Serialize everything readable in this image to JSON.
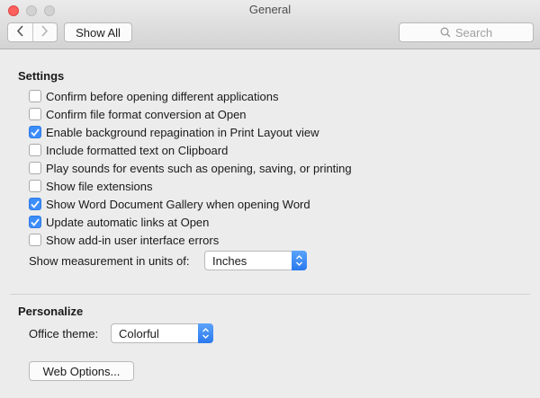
{
  "window": {
    "title": "General"
  },
  "toolbar": {
    "back_icon": "chevron-left-icon",
    "forward_icon": "chevron-right-icon",
    "show_all_label": "Show All",
    "search_placeholder": "Search"
  },
  "settings": {
    "heading": "Settings",
    "options": [
      {
        "label": "Confirm before opening different applications",
        "checked": false
      },
      {
        "label": "Confirm file format conversion at Open",
        "checked": false
      },
      {
        "label": "Enable background repagination in Print Layout view",
        "checked": true
      },
      {
        "label": "Include formatted text on Clipboard",
        "checked": false
      },
      {
        "label": "Play sounds for events such as opening, saving, or printing",
        "checked": false
      },
      {
        "label": "Show file extensions",
        "checked": false
      },
      {
        "label": "Show Word Document Gallery when opening Word",
        "checked": true
      },
      {
        "label": "Update automatic links at Open",
        "checked": true
      },
      {
        "label": "Show add-in user interface errors",
        "checked": false
      }
    ],
    "units_label": "Show measurement in units of:",
    "units_value": "Inches"
  },
  "personalize": {
    "heading": "Personalize",
    "theme_label": "Office theme:",
    "theme_value": "Colorful",
    "web_options_label": "Web Options..."
  },
  "colors": {
    "accent": "#3c8dfa",
    "close": "#fc605c"
  }
}
